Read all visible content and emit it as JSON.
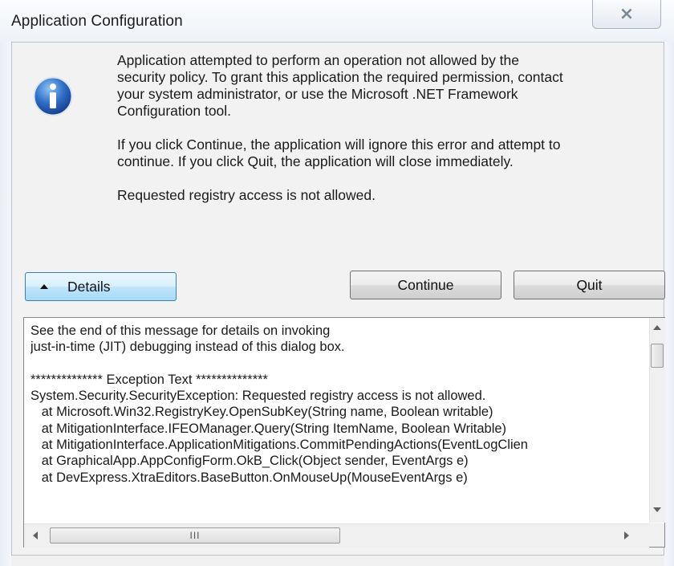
{
  "window": {
    "title": "Application Configuration",
    "close_glyph": "⨯",
    "accent": "#3c7fb1"
  },
  "message": {
    "icon": "info-icon",
    "paragraph1": "Application attempted to perform an operation not allowed by the\nsecurity policy. To grant this application the required permission, contact\nyour system administrator, or use the Microsoft .NET Framework\nConfiguration tool.",
    "paragraph2": "If you click Continue, the application will ignore this error and attempt to\ncontinue. If you click Quit, the application will close immediately.",
    "paragraph3": "Requested registry access is not allowed."
  },
  "buttons": {
    "details_label": "Details",
    "continue_label": "Continue",
    "quit_label": "Quit"
  },
  "details": {
    "text": "See the end of this message for details on invoking\njust-in-time (JIT) debugging instead of this dialog box.\n\n************** Exception Text **************\nSystem.Security.SecurityException: Requested registry access is not allowed.\n   at Microsoft.Win32.RegistryKey.OpenSubKey(String name, Boolean writable)\n   at MitigationInterface.IFEOManager.Query(String ItemName, Boolean Writable)\n   at MitigationInterface.ApplicationMitigations.CommitPendingActions(EventLogClien\n   at GraphicalApp.AppConfigForm.OkB_Click(Object sender, EventArgs e)\n   at DevExpress.XtraEditors.BaseButton.OnMouseUp(MouseEventArgs e)",
    "hscroll_grip": "III"
  }
}
